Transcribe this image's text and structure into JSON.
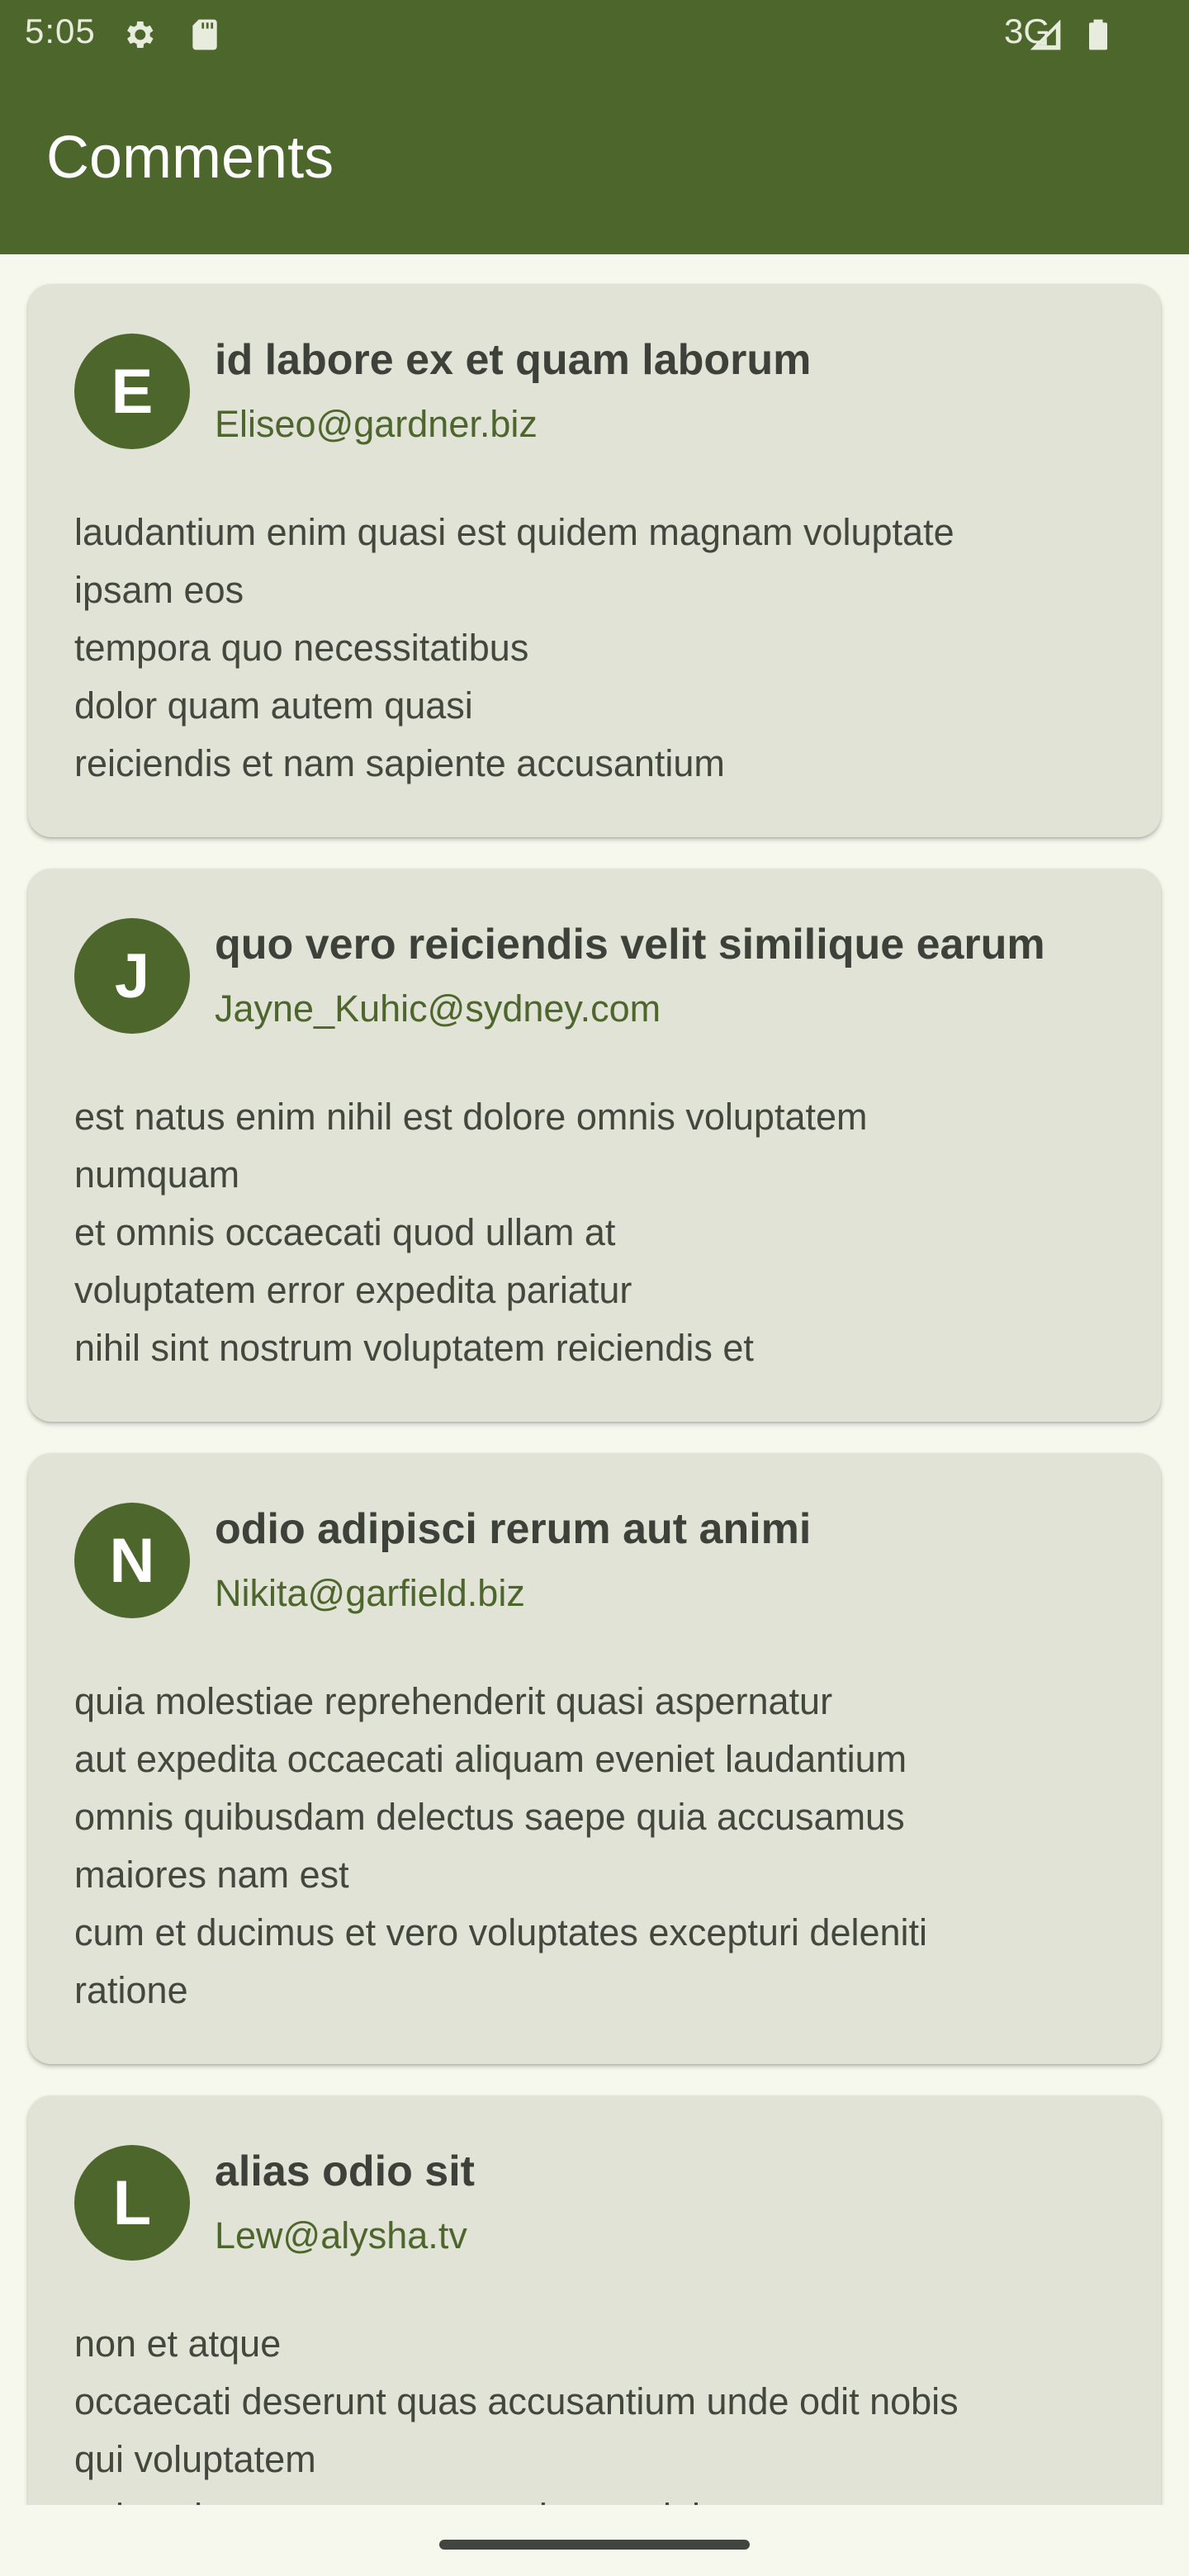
{
  "status_bar": {
    "time": "5:05",
    "network": "3G",
    "icons": [
      "gear-icon",
      "sd-card-icon",
      "signal-icon",
      "battery-icon"
    ]
  },
  "app_bar": {
    "title": "Comments"
  },
  "comments": [
    {
      "initial": "E",
      "title": "id labore ex et quam laborum",
      "email": "Eliseo@gardner.biz",
      "body_lines": [
        "laudantium enim quasi est quidem magnam voluptate",
        "ipsam eos",
        "tempora quo necessitatibus",
        "dolor quam autem quasi",
        "reiciendis et nam sapiente accusantium"
      ]
    },
    {
      "initial": "J",
      "title": "quo vero reiciendis velit similique earum",
      "email": "Jayne_Kuhic@sydney.com",
      "body_lines": [
        "est natus enim nihil est dolore omnis voluptatem",
        "numquam",
        "et omnis occaecati quod ullam at",
        "voluptatem error expedita pariatur",
        "nihil sint nostrum voluptatem reiciendis et"
      ]
    },
    {
      "initial": "N",
      "title": "odio adipisci rerum aut animi",
      "email": "Nikita@garfield.biz",
      "body_lines": [
        "quia molestiae reprehenderit quasi aspernatur",
        "aut expedita occaecati aliquam eveniet laudantium",
        "omnis quibusdam delectus saepe quia accusamus",
        "maiores nam est",
        "cum et ducimus et vero voluptates excepturi deleniti",
        "ratione"
      ]
    },
    {
      "initial": "L",
      "title": "alias odio sit",
      "email": "Lew@alysha.tv",
      "body_lines": [
        "non et atque",
        "occaecati deserunt quas accusantium unde odit nobis",
        "qui voluptatem",
        "quia voluptas consequuntur itaque dolor"
      ]
    }
  ],
  "colors": {
    "primary": "#4d662c",
    "card_background": "#e1e3d7",
    "page_background": "#f6f8ee",
    "title_text": "#3e413a",
    "body_text": "#43473e"
  }
}
